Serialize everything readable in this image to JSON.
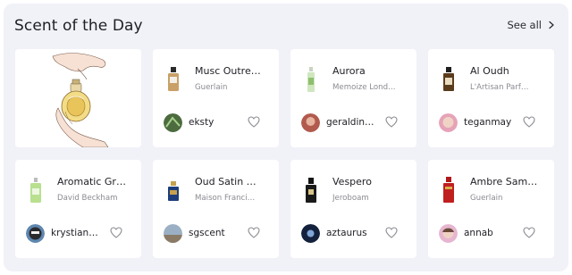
{
  "section": {
    "title": "Scent of the Day",
    "see_all_label": "See all"
  },
  "cards": [
    {
      "name": "Musc Outre…",
      "brand": "Guerlain",
      "user": "eksty",
      "bottle_color": "#3a2a1c",
      "avatar_color": "#4c6b3f"
    },
    {
      "name": "Aurora",
      "brand": "Memoize Lond…",
      "user": "geraldin…",
      "bottle_color": "#a7c98c",
      "avatar_color": "#b25a4e"
    },
    {
      "name": "Al Oudh",
      "brand": "L'Artisan Parf…",
      "user": "teganmay",
      "bottle_color": "#6a4a24",
      "avatar_color": "#d9b6a6"
    },
    {
      "name": "Aromatic Gr…",
      "brand": "David Beckham",
      "user": "krystian…",
      "bottle_color": "#9fcf78",
      "avatar_color": "#2a2a2e"
    },
    {
      "name": "Oud Satin …",
      "brand": "Maison Franci…",
      "user": "sgscent",
      "bottle_color": "#1d3e7a",
      "avatar_color": "#8ea3b8"
    },
    {
      "name": "Vespero",
      "brand": "Jeroboam",
      "user": "aztaurus",
      "bottle_color": "#141414",
      "avatar_color": "#1b2a4a"
    },
    {
      "name": "Ambre Sam…",
      "brand": "Guerlain",
      "user": "annab",
      "bottle_color": "#b01a1a",
      "avatar_color": "#e8c0b0"
    }
  ]
}
